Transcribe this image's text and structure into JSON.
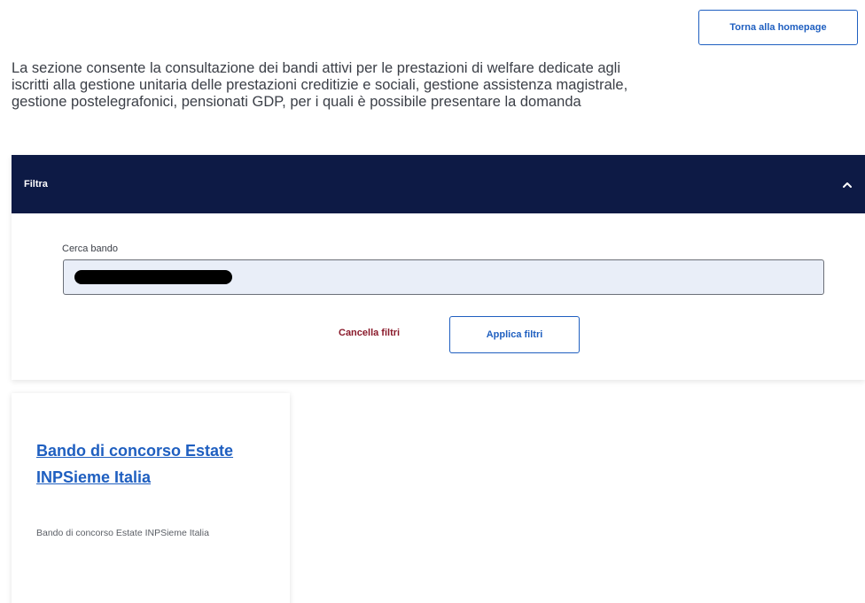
{
  "header": {
    "home_button_label": "Torna alla homepage"
  },
  "intro": {
    "text": "La sezione consente la consultazione dei bandi attivi per le prestazioni di welfare dedicate agli iscritti alla gestione unitaria delle prestazioni creditizie e sociali, gestione assistenza magistrale, gestione postelegrafonici, pensionati GDP, per i quali è possibile presentare la domanda"
  },
  "filter": {
    "title": "Filtra",
    "toggle_icon": "chevron-up-icon",
    "search_label": "Cerca bando",
    "search_value": "",
    "search_value_redacted": true,
    "clear_label": "Cancella filtri",
    "apply_label": "Applica filtri"
  },
  "results": [
    {
      "title": "Bando di concorso Estate INPSieme Italia",
      "description": "Bando di concorso Estate INPSieme Italia"
    }
  ],
  "colors": {
    "header_bg": "#0d1a45",
    "accent": "#1f5fc0",
    "clear_link": "#8a1a2b",
    "input_bg": "#e9eef8"
  }
}
